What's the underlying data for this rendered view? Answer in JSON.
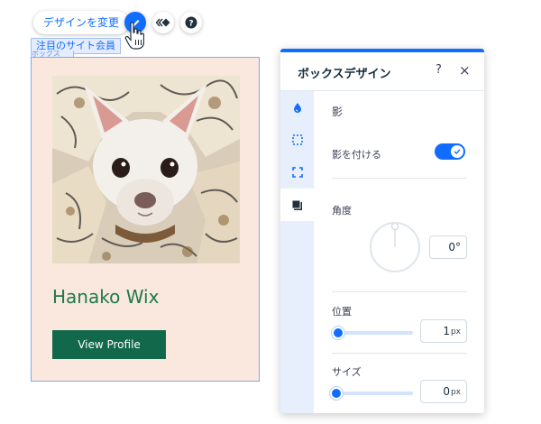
{
  "toolbar": {
    "change_design_label": "デザインを変更",
    "design_icon": "paint-brush-icon",
    "animation_icon": "animation-icon",
    "help_icon": "question-icon"
  },
  "selection": {
    "component_tag": "注目のサイト会員",
    "sub_tag": "ボックス"
  },
  "card": {
    "member_name": "Hanako Wix",
    "profile_button_label": "View Profile"
  },
  "panel": {
    "title": "ボックスデザイン",
    "help_label": "?",
    "close_label": "×",
    "tabs": [
      {
        "icon": "fill-drop-icon"
      },
      {
        "icon": "border-icon"
      },
      {
        "icon": "corners-icon"
      },
      {
        "icon": "shadow-icon"
      }
    ],
    "shadow": {
      "section_title": "影",
      "enable_label": "影を付ける",
      "enabled": true,
      "angle_label": "角度",
      "angle_value": "0°",
      "position_label": "位置",
      "position_value": "1",
      "position_unit": "px",
      "size_label": "サイズ",
      "size_value": "0",
      "size_unit": "px"
    }
  },
  "colors": {
    "accent": "#116dff",
    "card_bg": "#fae7dd",
    "name_green": "#1e7a4a",
    "button_green": "#12684b"
  }
}
